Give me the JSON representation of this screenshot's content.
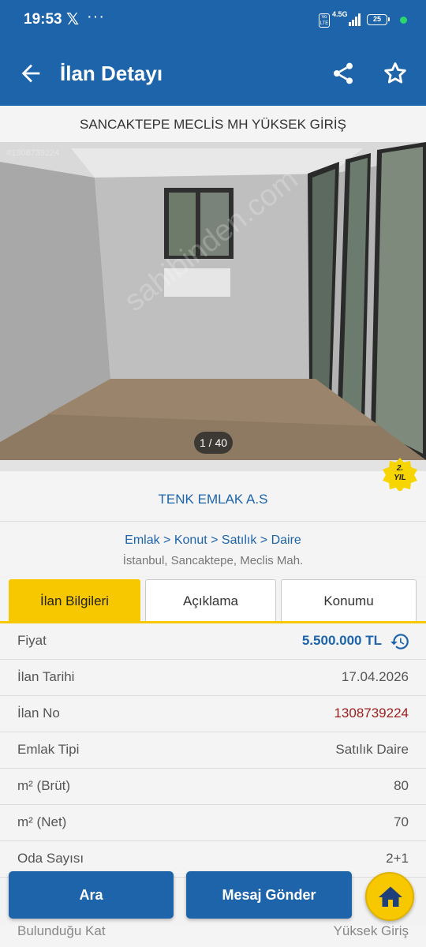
{
  "status_bar": {
    "time": "19:53",
    "x_logo": "𝕏",
    "more": "···",
    "volte": "Vo LTE",
    "network": "4.5G",
    "battery": "25"
  },
  "app_bar": {
    "title": "İlan Detayı",
    "back_icon": "arrow-left-icon",
    "share_icon": "share-icon",
    "favorite_icon": "star-outline-icon"
  },
  "listing": {
    "title": "SANCAKTEPE MECLİS MH YÜKSEK GİRİŞ",
    "photo": {
      "ad_number_overlay": "#1308739224",
      "watermark": "sahibinden.com",
      "counter": "1 / 40"
    },
    "seller": {
      "name": "TENK EMLAK A.S",
      "badge_line1": "2.",
      "badge_line2": "YIL"
    },
    "breadcrumb": "Emlak > Konut > Satılık > Daire",
    "location": "İstanbul, Sancaktepe, Meclis Mah."
  },
  "tabs": [
    {
      "label": "İlan Bilgileri",
      "active": true
    },
    {
      "label": "Açıklama",
      "active": false
    },
    {
      "label": "Konumu",
      "active": false
    }
  ],
  "details": [
    {
      "key": "Fiyat",
      "value": "5.500.000 TL"
    },
    {
      "key": "İlan Tarihi",
      "value": "17.04.2026"
    },
    {
      "key": "İlan No",
      "value": "1308739224"
    },
    {
      "key": "Emlak Tipi",
      "value": "Satılık Daire"
    },
    {
      "key": "m² (Brüt)",
      "value": "80"
    },
    {
      "key": "m² (Net)",
      "value": "70"
    },
    {
      "key": "Oda Sayısı",
      "value": "2+1"
    }
  ],
  "partial_row": {
    "key": "Bulunduğu Kat",
    "value": "Yüksek Giriş"
  },
  "actions": {
    "search": "Ara",
    "message": "Mesaj Gönder",
    "home_icon": "home-icon"
  },
  "colors": {
    "primary": "#1e64aa",
    "accent": "#f7c800",
    "ad_number": "#9b1e1e"
  }
}
